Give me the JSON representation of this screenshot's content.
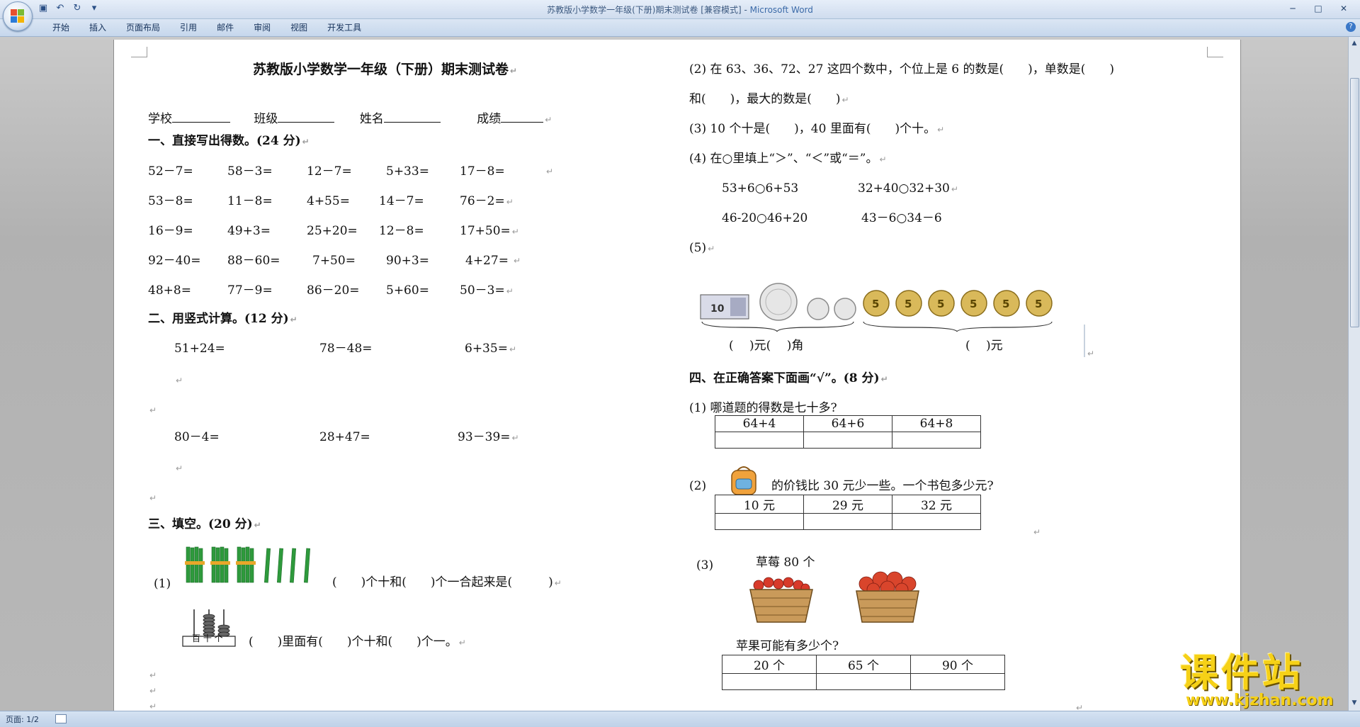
{
  "window": {
    "title": "苏教版小学数学一年级(下册)期末测试卷 [兼容模式]",
    "app_name": "Microsoft Word",
    "separator": " - "
  },
  "ribbon": {
    "tabs": [
      "开始",
      "插入",
      "页面布局",
      "引用",
      "邮件",
      "审阅",
      "视图",
      "开发工具"
    ]
  },
  "doc": {
    "title": "苏教版小学数学一年级（下册）期末测试卷",
    "info": {
      "school": "学校",
      "class": "班级",
      "name": "姓名",
      "score": "成绩"
    },
    "s1": {
      "heading": "一、直接写出得数。(24 分)",
      "rows": [
        [
          "52－7=",
          "58－3=",
          "12－7=",
          "5+33=",
          "17－8="
        ],
        [
          "53－8=",
          "11－8=",
          "4+55=",
          "14－7=",
          "76－2="
        ],
        [
          "16－9=",
          "49+3=",
          "25+20=",
          "12－8=",
          "17+50="
        ],
        [
          "92－40=",
          "88－60=",
          "7+50=",
          "90+3=",
          "4+27="
        ],
        [
          "48+8=",
          "77－9=",
          "86－20=",
          "5+60=",
          "50－3="
        ]
      ]
    },
    "s2": {
      "heading": "二、用竖式计算。(12 分)",
      "row1": [
        "51+24=",
        "78－48=",
        "6+35="
      ],
      "row2": [
        "80－4=",
        "28+47=",
        "93－39="
      ]
    },
    "s3": {
      "heading": "三、填空。(20 分)",
      "q1_label": "(1)",
      "q1_text": "(　　)个十和(　　)个一合起来是(　　　)",
      "abacus_labels": "百 十 个",
      "q1b_text": "(　　)里面有(　　)个十和(　　)个一。",
      "q2_line1": "(2) 在 63、36、72、27 这四个数中，个位上是 6 的数是(　　)，单数是(　　)",
      "q2_line2": "和(　　)，最大的数是(　　)",
      "q3": "(3) 10 个十是(　　)，40 里面有(　　)个十。",
      "q4": "(4) 在○里填上“＞”、“＜”或“＝”。",
      "q4_items": [
        "53+6○6+53",
        "32+40○32+30",
        "46-20○46+20",
        "43－6○34－6"
      ],
      "q5": "(5)",
      "q5_money_left": "(　 )元(　 )角",
      "q5_money_right": "(　 )元",
      "banknote_value": "10",
      "coin_face": "5"
    },
    "s4": {
      "heading": "四、在正确答案下面画“√”。(8 分)",
      "q1": "(1) 哪道题的得数是七十多?",
      "q1_opts": [
        "64+4",
        "64+6",
        "64+8"
      ],
      "q2_label": "(2)",
      "q2_text": "的价钱比 30 元少一些。一个书包多少元?",
      "q2_opts": [
        "10 元",
        "29 元",
        "32 元"
      ],
      "q3_label": "(3)",
      "q3_fruit": "草莓 80 个",
      "q3_question": "苹果可能有多少个?",
      "q3_opts": [
        "20 个",
        "65 个",
        "90 个"
      ]
    },
    "para_mark": "↵"
  },
  "status": {
    "page": "页面: 1/2"
  },
  "watermark": {
    "site_name": "课件站",
    "url": "www.kjzhan.com"
  },
  "colors": {
    "accent": "#3b6aa8",
    "watermark": "#f6d117",
    "bamboo": "#2e9a3c"
  }
}
